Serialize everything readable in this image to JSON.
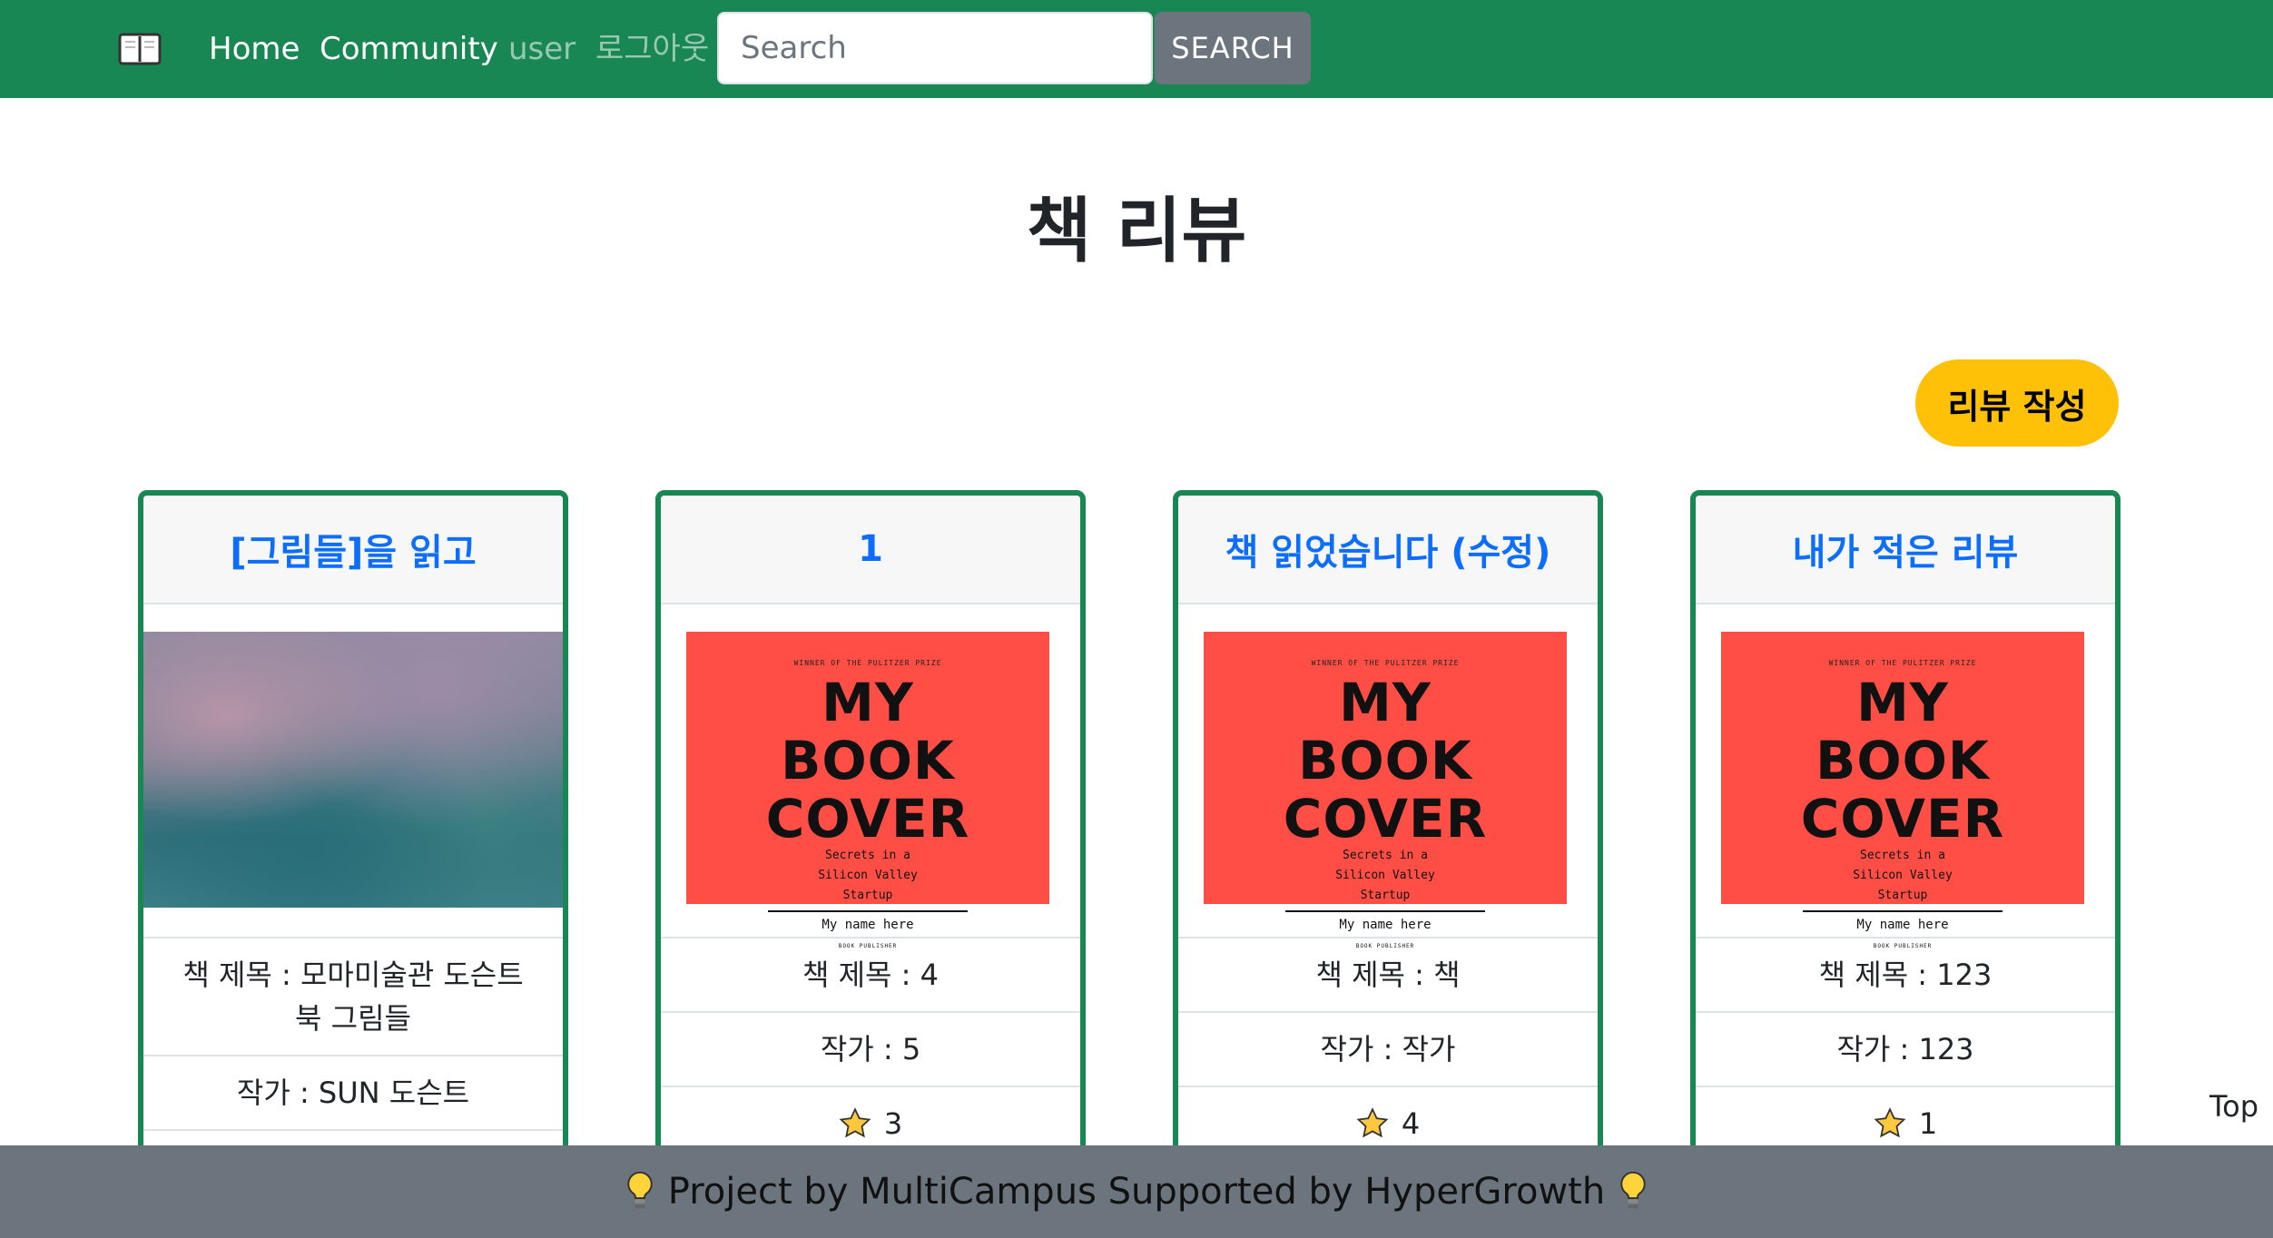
{
  "nav": {
    "home": "Home",
    "community": "Community",
    "user": "user",
    "logout": "로그아웃",
    "search_placeholder": "Search",
    "search_button": "SEARCH"
  },
  "page": {
    "title": "책 리뷰",
    "write_button": "리뷰 작성"
  },
  "cards": [
    {
      "title": "[그림들]을 읽고",
      "book": "책 제목 : 모마미술관 도슨트 북 그림들",
      "author": "작가 : SUN 도슨트",
      "image": "painting"
    },
    {
      "title": "1",
      "book": "책 제목 : 4",
      "author": "작가 : 5",
      "rating": "3",
      "image": "book-cover"
    },
    {
      "title": "책 읽었습니다 (수정)",
      "book": "책 제목 : 책",
      "author": "작가 : 작가",
      "rating": "4",
      "image": "book-cover"
    },
    {
      "title": "내가 적은 리뷰",
      "book": "책 제목 : 123",
      "author": "작가 : 123",
      "rating": "1",
      "image": "book-cover"
    }
  ],
  "cover": {
    "prize": "WINNER OF THE PULITZER PRIZE",
    "line1": "MY",
    "line2": "BOOK",
    "line3": "COVER",
    "subtitle1": "Secrets in a",
    "subtitle2": "Silicon Valley",
    "subtitle3": "Startup",
    "name": "My name here",
    "publisher": "BOOK PUBLISHER"
  },
  "top_link": "Top",
  "footer": {
    "text": "Project by MultiCampus Supported by HyperGrowth"
  },
  "colors": {
    "navbar": "#198754",
    "link": "#0d6efd",
    "accent": "#ffc107",
    "footer": "#6c757d",
    "cover": "#ff4e45"
  }
}
